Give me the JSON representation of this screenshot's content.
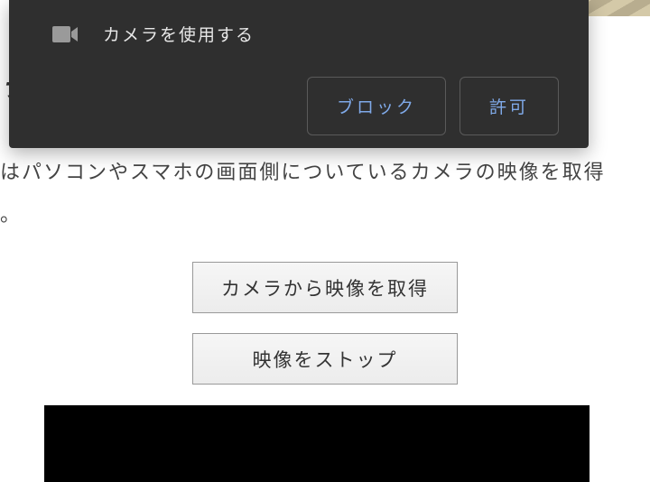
{
  "dialog": {
    "title": "カメラを使用する",
    "block_label": "ブロック",
    "allow_label": "許可"
  },
  "page": {
    "title_fragment": "ラ",
    "description_line": "はパソコンやスマホの画面側についているカメラの映像を取得",
    "description_tail": "。",
    "get_video_label": "カメラから映像を取得",
    "stop_video_label": "映像をストップ"
  }
}
